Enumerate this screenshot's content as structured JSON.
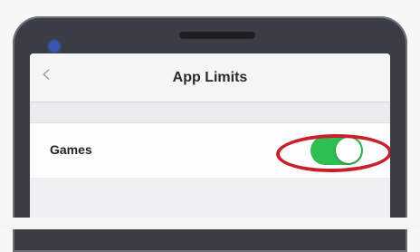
{
  "nav": {
    "title": "App Limits",
    "back_icon": "chevron-left-icon"
  },
  "settings": {
    "row_label": "Games",
    "toggle_state": "on"
  },
  "colors": {
    "toggle_on": "#2fbf52",
    "highlight_ring": "#c8202c",
    "phone_frame": "#3b3d45"
  }
}
